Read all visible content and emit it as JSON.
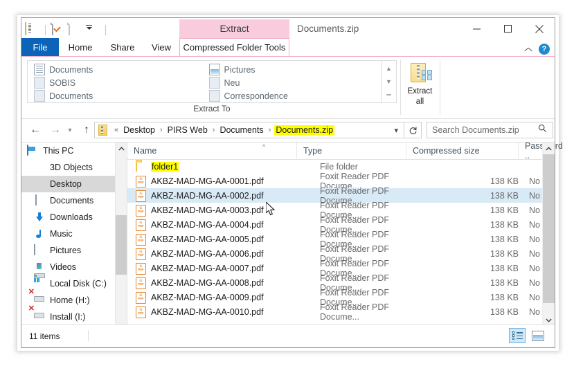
{
  "window": {
    "title": "Documents.zip",
    "minimize_label": "Minimize",
    "maximize_label": "Maximize",
    "close_label": "Close",
    "help_label": "?",
    "collapse_ribbon_label": "Collapse Ribbon"
  },
  "quick_access": {
    "items": [
      {
        "name": "zip-icon",
        "label": "Documents.zip"
      },
      {
        "name": "properties-icon",
        "label": "Properties"
      },
      {
        "name": "new-folder-icon",
        "label": "New folder"
      },
      {
        "name": "customize-caret-icon",
        "label": "Customize Quick Access Toolbar"
      }
    ]
  },
  "contextual_tab_header": "Extract",
  "tabs": [
    {
      "label": "File",
      "state": "file"
    },
    {
      "label": "Home",
      "state": "normal"
    },
    {
      "label": "Share",
      "state": "normal"
    },
    {
      "label": "View",
      "state": "normal"
    },
    {
      "label": "Compressed Folder Tools",
      "state": "contextual-active"
    }
  ],
  "ribbon": {
    "group_label": "Extract To",
    "gallery": [
      {
        "label": "Documents",
        "icon": "document-icon"
      },
      {
        "label": "SOBIS",
        "icon": "folder-icon"
      },
      {
        "label": "Documents",
        "icon": "folder-icon"
      },
      {
        "label": "Pictures",
        "icon": "pictures-icon"
      },
      {
        "label": "Neu",
        "icon": "folder-icon"
      },
      {
        "label": "Correspondence",
        "icon": "folder-icon"
      }
    ],
    "extract_all": {
      "line1": "Extract",
      "line2": "all"
    }
  },
  "address_bar": {
    "back_label": "Back",
    "forward_label": "Forward",
    "recent_label": "Recent locations",
    "up_label": "Up",
    "overflow": "«",
    "breadcrumbs": [
      {
        "label": "Desktop",
        "highlight": false
      },
      {
        "label": "PIRS Web",
        "highlight": false
      },
      {
        "label": "Documents",
        "highlight": false
      },
      {
        "label": "Documents.zip",
        "highlight": true
      }
    ],
    "separator": "›",
    "dropdown_label": "Previous locations",
    "refresh_label": "Refresh",
    "search_placeholder": "Search Documents.zip"
  },
  "nav_pane": {
    "items": [
      {
        "label": "This PC",
        "icon": "pc-icon",
        "selected": false,
        "root": true
      },
      {
        "label": "3D Objects",
        "icon": "3d-objects-icon",
        "selected": false
      },
      {
        "label": "Desktop",
        "icon": "desktop-icon",
        "selected": true
      },
      {
        "label": "Documents",
        "icon": "documents-icon",
        "selected": false
      },
      {
        "label": "Downloads",
        "icon": "downloads-icon",
        "selected": false
      },
      {
        "label": "Music",
        "icon": "music-icon",
        "selected": false
      },
      {
        "label": "Pictures",
        "icon": "pictures-icon",
        "selected": false
      },
      {
        "label": "Videos",
        "icon": "videos-icon",
        "selected": false
      },
      {
        "label": "Local Disk (C:)",
        "icon": "local-disk-icon",
        "selected": false
      },
      {
        "label": "Home (H:)",
        "icon": "network-drive-offline-icon",
        "selected": false
      },
      {
        "label": "Install (I:)",
        "icon": "network-drive-offline-icon",
        "selected": false
      }
    ]
  },
  "columns": [
    {
      "key": "name",
      "label": "Name"
    },
    {
      "key": "type",
      "label": "Type"
    },
    {
      "key": "size",
      "label": "Compressed size"
    },
    {
      "key": "password",
      "label": "Password .."
    }
  ],
  "sort_indicator": "^",
  "files": [
    {
      "name": "folder1",
      "type": "File folder",
      "size": "",
      "password": "",
      "icon": "folder-icon",
      "highlight": true,
      "selected": false
    },
    {
      "name": "AKBZ-MAD-MG-AA-0001.pdf",
      "type": "Foxit Reader PDF Docume...",
      "size": "138 KB",
      "password": "No",
      "icon": "pdf-icon",
      "highlight": false,
      "selected": false
    },
    {
      "name": "AKBZ-MAD-MG-AA-0002.pdf",
      "type": "Foxit Reader PDF Docume...",
      "size": "138 KB",
      "password": "No",
      "icon": "pdf-icon",
      "highlight": false,
      "selected": true
    },
    {
      "name": "AKBZ-MAD-MG-AA-0003.pdf",
      "type": "Foxit Reader PDF Docume...",
      "size": "138 KB",
      "password": "No",
      "icon": "pdf-icon",
      "highlight": false,
      "selected": false
    },
    {
      "name": "AKBZ-MAD-MG-AA-0004.pdf",
      "type": "Foxit Reader PDF Docume...",
      "size": "138 KB",
      "password": "No",
      "icon": "pdf-icon",
      "highlight": false,
      "selected": false
    },
    {
      "name": "AKBZ-MAD-MG-AA-0005.pdf",
      "type": "Foxit Reader PDF Docume...",
      "size": "138 KB",
      "password": "No",
      "icon": "pdf-icon",
      "highlight": false,
      "selected": false
    },
    {
      "name": "AKBZ-MAD-MG-AA-0006.pdf",
      "type": "Foxit Reader PDF Docume...",
      "size": "138 KB",
      "password": "No",
      "icon": "pdf-icon",
      "highlight": false,
      "selected": false
    },
    {
      "name": "AKBZ-MAD-MG-AA-0007.pdf",
      "type": "Foxit Reader PDF Docume...",
      "size": "138 KB",
      "password": "No",
      "icon": "pdf-icon",
      "highlight": false,
      "selected": false
    },
    {
      "name": "AKBZ-MAD-MG-AA-0008.pdf",
      "type": "Foxit Reader PDF Docume...",
      "size": "138 KB",
      "password": "No",
      "icon": "pdf-icon",
      "highlight": false,
      "selected": false
    },
    {
      "name": "AKBZ-MAD-MG-AA-0009.pdf",
      "type": "Foxit Reader PDF Docume...",
      "size": "138 KB",
      "password": "No",
      "icon": "pdf-icon",
      "highlight": false,
      "selected": false
    },
    {
      "name": "AKBZ-MAD-MG-AA-0010.pdf",
      "type": "Foxit Reader PDF Docume...",
      "size": "138 KB",
      "password": "No",
      "icon": "pdf-icon",
      "highlight": false,
      "selected": false
    }
  ],
  "status": {
    "item_count": "11 items",
    "view_details_label": "Details view",
    "view_large_icons_label": "Large icons view"
  },
  "colors": {
    "file_tab": "#0b64b7",
    "contextual_pink": "#f9ccdd",
    "highlight_yellow": "#ffff00",
    "selection_blue": "#d9eaf7",
    "nav_selection": "#d8d8d8"
  }
}
